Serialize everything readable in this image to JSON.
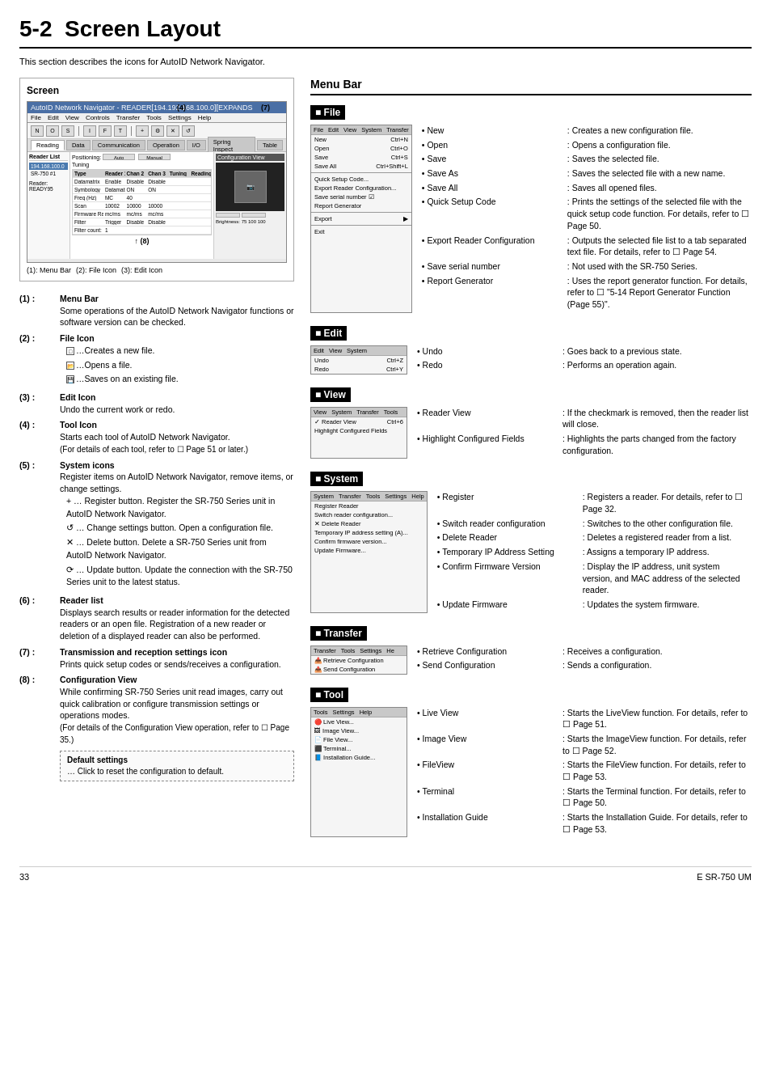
{
  "page": {
    "chapter": "5-2",
    "title": "Screen Layout",
    "footer_page": "33",
    "footer_doc": "E SR-750 UM"
  },
  "intro": {
    "text": "This section describes the icons for AutoID Network Navigator."
  },
  "screen_section": {
    "title": "Screen",
    "screenshot": {
      "title_bar": "AutoID Network Navigator - READER[194.192.168.100.0][EXPANDS",
      "menu_items": [
        "File",
        "Edit",
        "View",
        "Controls",
        "Transfer",
        "Tools",
        "Settings",
        "Help"
      ],
      "tabs": [
        "Reading",
        "Data",
        "Communication",
        "Communication",
        "Operation",
        "I/O",
        "Spring Inspect",
        "Table"
      ],
      "sim_tabs_active": "Reading"
    },
    "callouts": {
      "c4": "(4)",
      "c7": "(7)",
      "c8": "(8)"
    }
  },
  "annotations": [
    {
      "num": "(1)",
      "label": "Menu Bar",
      "text": "Some operations of the AutoID Network Navigator functions or software version can be checked."
    },
    {
      "num": "(2)",
      "label": "File Icon",
      "items": [
        "…Creates a new file.",
        "…Opens a file.",
        "…Saves on an existing file."
      ]
    },
    {
      "num": "(3)",
      "label": "Edit Icon",
      "text": "Undo the current work or redo."
    },
    {
      "num": "(4)",
      "label": "Tool Icon",
      "text": "Starts each tool of AutoID Network Navigator.",
      "note": "(For details of each tool, refer to ☐ Page 51 or later.)"
    },
    {
      "num": "(5)",
      "label": "System icons",
      "text": "Register items on AutoID Network Navigator, remove items, or change settings.",
      "sub_items": [
        "+ … Register button. Register the SR-750 Series unit in AutoID Network Navigator.",
        "↺ … Change settings button. Open a configuration file.",
        "✕ … Delete button. Delete a SR-750 Series unit from AutoID Network Navigator.",
        "⟳ … Update button. Update the connection with the SR-750 Series unit to the latest status."
      ]
    },
    {
      "num": "(6)",
      "label": "Reader list",
      "text": "Displays search results or reader information for the detected readers or an open file. Registration of a new reader or deletion of a displayed reader can also be performed."
    },
    {
      "num": "(7)",
      "label": "Transmission and reception settings icon",
      "text": "Prints quick setup codes or sends/receives a configuration."
    },
    {
      "num": "(8)",
      "label": "Configuration View",
      "text": "While confirming SR-750 Series unit read images, carry out quick calibration or configure transmission settings or operations modes.",
      "note": "(For details of the Configuration View operation, refer to ☐ Page 35.)",
      "default": "Default settings",
      "default_note": "… Click to reset the configuration to default."
    }
  ],
  "menu_bar": {
    "title": "Menu Bar",
    "sections": [
      {
        "name": "File",
        "menu_image": {
          "bar": [
            "File",
            "Edit",
            "View",
            "System",
            "Transfer"
          ],
          "items": [
            {
              "label": "New",
              "shortcut": "Ctrl+N"
            },
            {
              "label": "Open",
              "shortcut": "Ctrl+O"
            },
            {
              "label": "Save",
              "shortcut": "Ctrl+S"
            },
            {
              "label": "Save All",
              "shortcut": "Ctrl+Shift+L"
            },
            {
              "label": "Quick Setup Code...",
              "shortcut": ""
            },
            {
              "label": "Export Reader Configuration...",
              "shortcut": ""
            },
            {
              "label": "Save serial number ☑",
              "shortcut": ""
            },
            {
              "label": "Report Generator",
              "shortcut": ""
            },
            {
              "label": "Export",
              "shortcut": "▶"
            },
            {
              "label": "Exit",
              "shortcut": ""
            }
          ]
        },
        "desc_items": [
          {
            "key": "New",
            "val": "Creates a new configuration file."
          },
          {
            "key": "Open",
            "val": "Opens a configuration file."
          },
          {
            "key": "Save",
            "val": "Saves the selected file."
          },
          {
            "key": "Save As",
            "val": "Saves the selected file with a new name."
          },
          {
            "key": "Save All",
            "val": "Saves all opened files."
          },
          {
            "key": "Quick Setup Code",
            "val": "Prints the settings of the selected file with the quick setup code function.  For details, refer to ☐ Page 50."
          },
          {
            "key": "Export Reader Configuration",
            "val": "Outputs the selected file list to a tab separated text file. For details, refer to ☐ Page 54."
          },
          {
            "key": "Save serial number",
            "val": "Not used with the SR-750 Series."
          },
          {
            "key": "Report Generator",
            "val": "Uses the report generator function. For details, refer to ☐ \"5-14 Report Generator Function (Page 55)\"."
          }
        ]
      },
      {
        "name": "Edit",
        "menu_image": {
          "bar": [
            "Edit",
            "View",
            "System"
          ],
          "items": [
            {
              "label": "Undo  Ctrl+Z",
              "shortcut": ""
            },
            {
              "label": "Redo  Ctrl+Y",
              "shortcut": ""
            }
          ]
        },
        "desc_items": [
          {
            "key": "Undo",
            "val": "Goes back to a previous state."
          },
          {
            "key": "Redo",
            "val": "Performs an operation again."
          }
        ]
      },
      {
        "name": "View",
        "menu_image": {
          "bar": [
            "View",
            "System",
            "Transfer",
            "Tools"
          ],
          "items": [
            {
              "label": "✓ Reader View",
              "shortcut": "Ctrl+6"
            },
            {
              "label": "Highlight Configured Fields",
              "shortcut": ""
            }
          ]
        },
        "desc_items": [
          {
            "key": "Reader View",
            "val": "If the checkmark is removed, then the reader list will close."
          },
          {
            "key": "Highlight Configured Fields",
            "val": "Highlights the parts changed from the factory configuration."
          }
        ]
      },
      {
        "name": "System",
        "menu_image": {
          "bar": [
            "System",
            "Transfer",
            "Tools",
            "Settings",
            "Help"
          ],
          "items": [
            {
              "label": "Register Reader",
              "shortcut": ""
            },
            {
              "label": "Switch reader configuration...",
              "shortcut": ""
            },
            {
              "label": "✕ Delete Reader",
              "shortcut": ""
            },
            {
              "label": "Temporary IP address setting (A)...",
              "shortcut": ""
            },
            {
              "label": "Confirm firmware version...",
              "shortcut": ""
            },
            {
              "label": "Update Firmware...",
              "shortcut": ""
            }
          ]
        },
        "desc_items": [
          {
            "key": "Register",
            "val": "Registers a reader. For details, refer to ☐ Page 32."
          },
          {
            "key": "Switch reader configuration",
            "val": "Switches to the other configuration file."
          },
          {
            "key": "Delete Reader",
            "val": "Deletes a registered reader from a list."
          },
          {
            "key": "Temporary IP Address Setting",
            "val": "Assigns a temporary IP address."
          },
          {
            "key": "Confirm Firmware Version",
            "val": "Display the IP address, unit system version, and MAC address of the selected reader."
          },
          {
            "key": "Update Firmware",
            "val": "Updates the system firmware."
          }
        ]
      },
      {
        "name": "Transfer",
        "menu_image": {
          "bar": [
            "Transfer",
            "Tools",
            "Settings",
            "He"
          ],
          "items": [
            {
              "label": "Retrieve Configuration",
              "shortcut": ""
            },
            {
              "label": "Send Configuration",
              "shortcut": ""
            }
          ]
        },
        "desc_items": [
          {
            "key": "Retrieve Configuration",
            "val": "Receives a configuration."
          },
          {
            "key": "Send Configuration",
            "val": "Sends a configuration."
          }
        ]
      },
      {
        "name": "Tool",
        "menu_image": {
          "bar": [
            "Tools",
            "Settings",
            "Help"
          ],
          "items": [
            {
              "label": "Live View...",
              "shortcut": ""
            },
            {
              "label": "Image View...",
              "shortcut": ""
            },
            {
              "label": "File View...",
              "shortcut": ""
            },
            {
              "label": "Terminal...",
              "shortcut": ""
            },
            {
              "label": "Installation Guide...",
              "shortcut": ""
            }
          ]
        },
        "desc_items": [
          {
            "key": "Live View",
            "val": "Starts the LiveView function. For details, refer to ☐ Page 51."
          },
          {
            "key": "Image View",
            "val": "Starts the ImageView function. For details, refer to ☐ Page 52."
          },
          {
            "key": "FileView",
            "val": "Starts the FileView function. For details, refer to ☐ Page 53."
          },
          {
            "key": "Terminal",
            "val": "Starts the Terminal function. For details, refer to ☐ Page 50."
          },
          {
            "key": "Installation Guide",
            "val": "Starts the Installation Guide. For details, refer to ☐ Page 53."
          }
        ]
      }
    ]
  }
}
